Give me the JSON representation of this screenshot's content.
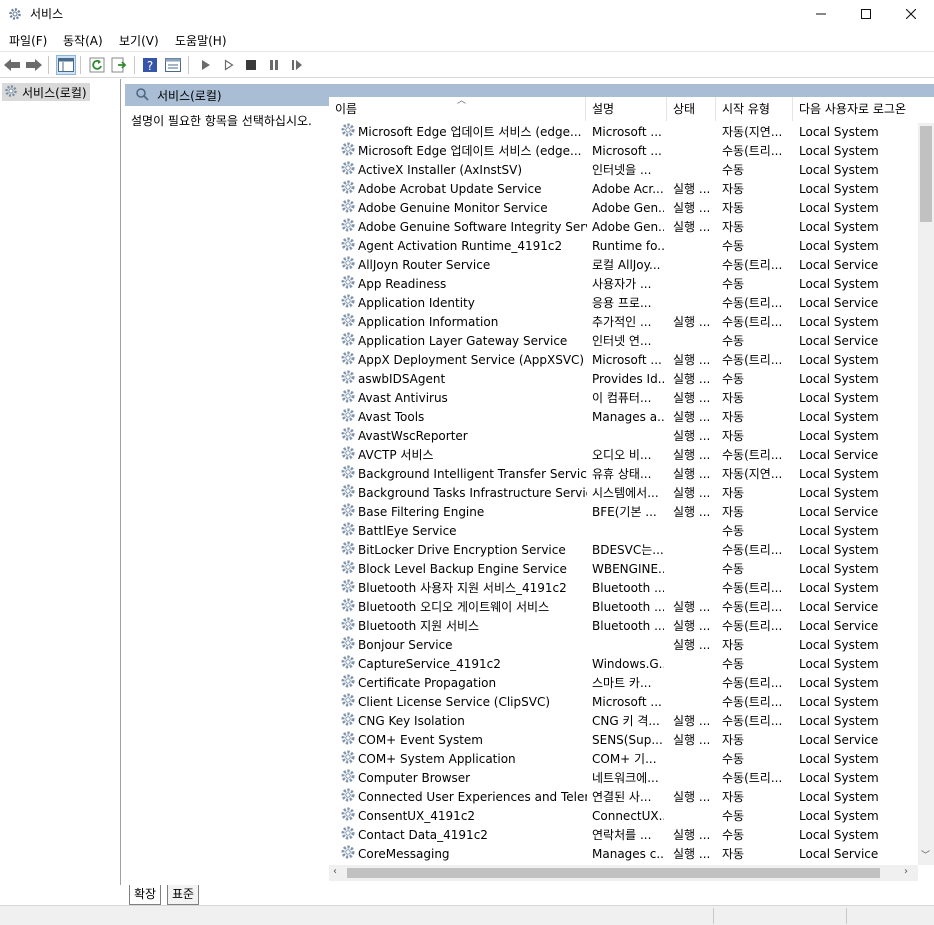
{
  "window": {
    "title": "서비스"
  },
  "menu": [
    "파일(F)",
    "동작(A)",
    "보기(V)",
    "도움말(H)"
  ],
  "toolbar_icons": [
    "back-arrow-icon",
    "forward-arrow-icon",
    "show-hide-console-tree-icon",
    "refresh-icon",
    "export-list-icon",
    "help-icon",
    "properties-pane-icon",
    "start-service-icon",
    "start-service-alt-icon",
    "stop-service-icon",
    "pause-service-icon",
    "resume-service-icon"
  ],
  "tree": {
    "root_label": "서비스(로컬)"
  },
  "pane": {
    "header": "서비스(로컬)",
    "description": "설명이 필요한 항목을 선택하십시오."
  },
  "columns": {
    "name": "이름",
    "description": "설명",
    "status": "상태",
    "startup": "시작 유형",
    "logon": "다음 사용자로 로그온"
  },
  "services": [
    {
      "name": " Microsoft Edge 업데이트 서비스 (edge...",
      "desc": "Microsoft ...",
      "status": "",
      "startup": "자동(지연...",
      "logon": "Local System"
    },
    {
      "name": " Microsoft Edge 업데이트 서비스 (edge...",
      "desc": "Microsoft ...",
      "status": "",
      "startup": "수동(트리...",
      "logon": "Local System"
    },
    {
      "name": "ActiveX Installer (AxInstSV)",
      "desc": "인터넷을 ...",
      "status": "",
      "startup": "수동",
      "logon": "Local System"
    },
    {
      "name": "Adobe Acrobat Update Service",
      "desc": "Adobe Acr...",
      "status": "실행 ...",
      "startup": "자동",
      "logon": "Local System"
    },
    {
      "name": "Adobe Genuine Monitor Service",
      "desc": "Adobe Gen...",
      "status": "실행 ...",
      "startup": "자동",
      "logon": "Local System"
    },
    {
      "name": "Adobe Genuine Software Integrity Service",
      "desc": "Adobe Gen...",
      "status": "실행 ...",
      "startup": "자동",
      "logon": "Local System"
    },
    {
      "name": "Agent Activation Runtime_4191c2",
      "desc": "Runtime fo...",
      "status": "",
      "startup": "수동",
      "logon": "Local System"
    },
    {
      "name": "AllJoyn Router Service",
      "desc": "로컬 AllJoy...",
      "status": "",
      "startup": "수동(트리...",
      "logon": "Local Service"
    },
    {
      "name": "App Readiness",
      "desc": "사용자가 ...",
      "status": "",
      "startup": "수동",
      "logon": "Local System"
    },
    {
      "name": "Application Identity",
      "desc": "응용 프로...",
      "status": "",
      "startup": "수동(트리...",
      "logon": "Local Service"
    },
    {
      "name": "Application Information",
      "desc": "추가적인 ...",
      "status": "실행 ...",
      "startup": "수동(트리...",
      "logon": "Local System"
    },
    {
      "name": "Application Layer Gateway Service",
      "desc": "인터넷 연...",
      "status": "",
      "startup": "수동",
      "logon": "Local Service"
    },
    {
      "name": "AppX Deployment Service (AppXSVC)",
      "desc": "Microsoft ...",
      "status": "실행 ...",
      "startup": "수동(트리...",
      "logon": "Local System"
    },
    {
      "name": "aswbIDSAgent",
      "desc": "Provides Id...",
      "status": "실행 ...",
      "startup": "수동",
      "logon": "Local System"
    },
    {
      "name": "Avast Antivirus",
      "desc": "이 컴퓨터...",
      "status": "실행 ...",
      "startup": "자동",
      "logon": "Local System"
    },
    {
      "name": "Avast Tools",
      "desc": "Manages a...",
      "status": "실행 ...",
      "startup": "자동",
      "logon": "Local System"
    },
    {
      "name": "AvastWscReporter",
      "desc": "",
      "status": "실행 ...",
      "startup": "자동",
      "logon": "Local System"
    },
    {
      "name": "AVCTP 서비스",
      "desc": "오디오 비...",
      "status": "실행 ...",
      "startup": "수동(트리...",
      "logon": "Local Service"
    },
    {
      "name": "Background Intelligent Transfer Service",
      "desc": "유휴 상태...",
      "status": "실행 ...",
      "startup": "자동(지연...",
      "logon": "Local System"
    },
    {
      "name": "Background Tasks Infrastructure Service",
      "desc": "시스템에서...",
      "status": "실행 ...",
      "startup": "자동",
      "logon": "Local System"
    },
    {
      "name": "Base Filtering Engine",
      "desc": "BFE(기본 ...",
      "status": "실행 ...",
      "startup": "자동",
      "logon": "Local Service"
    },
    {
      "name": "BattlEye Service",
      "desc": "",
      "status": "",
      "startup": "수동",
      "logon": "Local System"
    },
    {
      "name": "BitLocker Drive Encryption Service",
      "desc": "BDESVC는...",
      "status": "",
      "startup": "수동(트리...",
      "logon": "Local System"
    },
    {
      "name": "Block Level Backup Engine Service",
      "desc": "WBENGINE...",
      "status": "",
      "startup": "수동",
      "logon": "Local System"
    },
    {
      "name": "Bluetooth 사용자 지원 서비스_4191c2",
      "desc": "Bluetooth ...",
      "status": "",
      "startup": "수동(트리...",
      "logon": "Local System"
    },
    {
      "name": "Bluetooth 오디오 게이트웨이 서비스",
      "desc": "Bluetooth ...",
      "status": "실행 ...",
      "startup": "수동(트리...",
      "logon": "Local Service"
    },
    {
      "name": "Bluetooth 지원 서비스",
      "desc": "Bluetooth ...",
      "status": "실행 ...",
      "startup": "수동(트리...",
      "logon": "Local Service"
    },
    {
      "name": "Bonjour Service",
      "desc": "",
      "status": "실행 ...",
      "startup": "자동",
      "logon": "Local System"
    },
    {
      "name": "CaptureService_4191c2",
      "desc": "Windows.G...",
      "status": "",
      "startup": "수동",
      "logon": "Local System"
    },
    {
      "name": "Certificate Propagation",
      "desc": "스마트 카...",
      "status": "",
      "startup": "수동(트리...",
      "logon": "Local System"
    },
    {
      "name": "Client License Service (ClipSVC)",
      "desc": "Microsoft ...",
      "status": "",
      "startup": "수동(트리...",
      "logon": "Local System"
    },
    {
      "name": "CNG Key Isolation",
      "desc": "CNG 키 격...",
      "status": "실행 ...",
      "startup": "수동(트리...",
      "logon": "Local System"
    },
    {
      "name": "COM+ Event System",
      "desc": "SENS(Sup...",
      "status": "실행 ...",
      "startup": "자동",
      "logon": "Local Service"
    },
    {
      "name": "COM+ System Application",
      "desc": "COM+ 기...",
      "status": "",
      "startup": "수동",
      "logon": "Local System"
    },
    {
      "name": "Computer Browser",
      "desc": "네트워크에...",
      "status": "",
      "startup": "수동(트리...",
      "logon": "Local System"
    },
    {
      "name": "Connected User Experiences and Telem...",
      "desc": "연결된 사...",
      "status": "실행 ...",
      "startup": "자동",
      "logon": "Local System"
    },
    {
      "name": "ConsentUX_4191c2",
      "desc": "ConnectUX...",
      "status": "",
      "startup": "수동",
      "logon": "Local System"
    },
    {
      "name": "Contact Data_4191c2",
      "desc": "연락처를 ...",
      "status": "실행 ...",
      "startup": "수동",
      "logon": "Local System"
    },
    {
      "name": "CoreMessaging",
      "desc": "Manages c...",
      "status": "실행 ...",
      "startup": "자동",
      "logon": "Local Service"
    }
  ],
  "tabs": [
    "확장",
    "표준"
  ]
}
